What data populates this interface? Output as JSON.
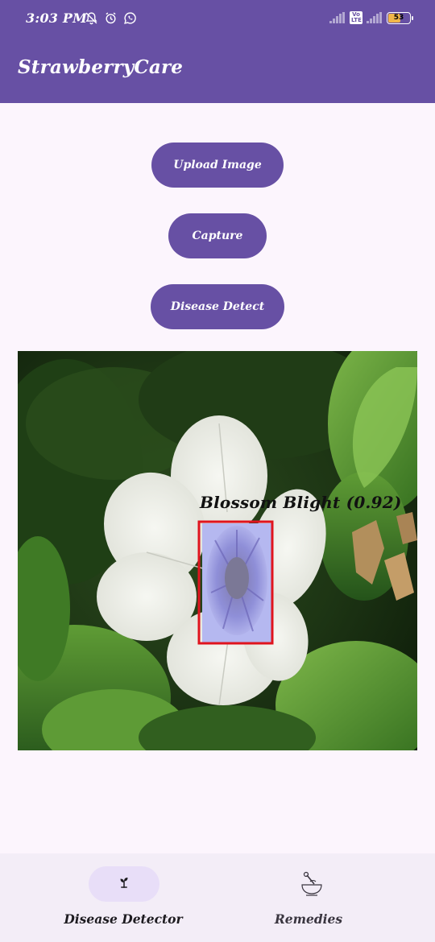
{
  "status_bar": {
    "time": "3:03 PM",
    "left_icons": [
      "notifications-off-icon",
      "alarm-icon",
      "whatsapp-icon"
    ],
    "right_icons": [
      "signal-icon",
      "volte-icon",
      "signal-icon",
      "battery-icon"
    ],
    "volte_text": "Vo LTE",
    "battery_level": "53"
  },
  "app_bar": {
    "title": "StrawberryCare"
  },
  "actions": {
    "upload_label": "Upload Image",
    "capture_label": "Capture",
    "detect_label": "Disease Detect"
  },
  "result": {
    "detection_label": "Blossom Blight (0.92)",
    "box_color": "#e0141e"
  },
  "bottom_nav": {
    "items": [
      {
        "label": "Disease Detector",
        "icon": "sprout-icon",
        "selected": true
      },
      {
        "label": "Remedies",
        "icon": "mortar-pestle-icon",
        "selected": false
      }
    ]
  },
  "colors": {
    "primary": "#6750a4",
    "background": "#fcf5fd",
    "nav_background": "#f3edf7",
    "nav_indicator": "#e8def8"
  }
}
